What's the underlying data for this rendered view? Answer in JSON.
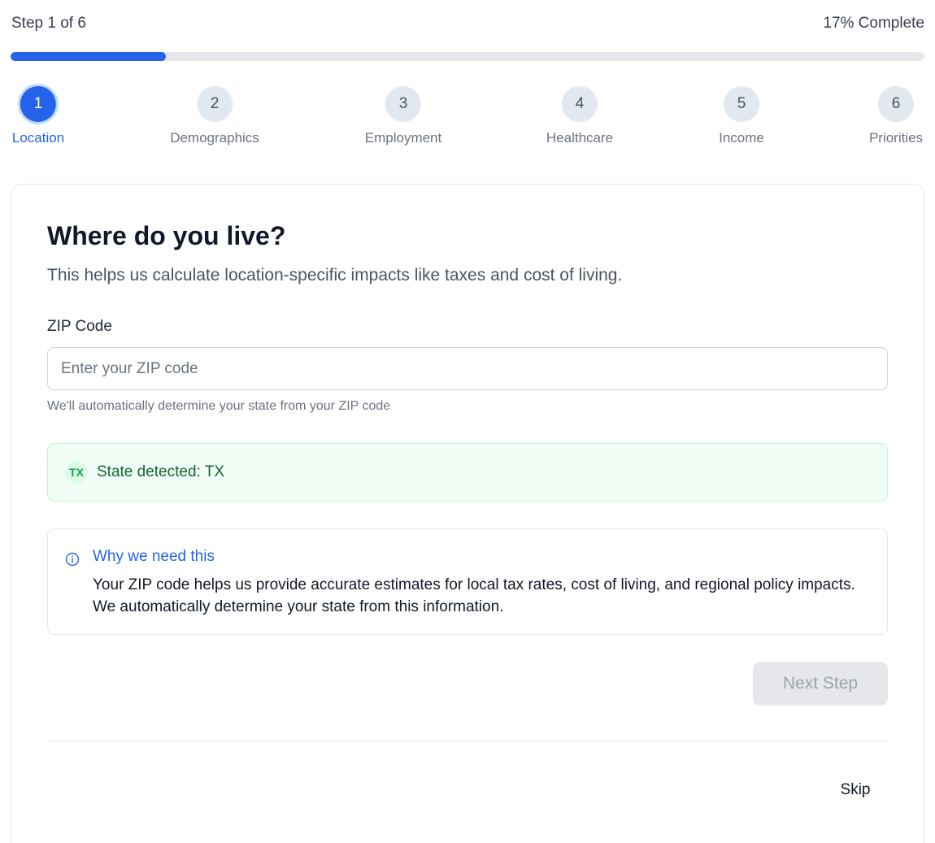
{
  "progress": {
    "step_text": "Step 1 of 6",
    "complete_text": "17% Complete",
    "fraction": 0.17,
    "accent_color": "#2563eb"
  },
  "steps": [
    {
      "number": "1",
      "label": "Location",
      "active": true
    },
    {
      "number": "2",
      "label": "Demographics",
      "active": false
    },
    {
      "number": "3",
      "label": "Employment",
      "active": false
    },
    {
      "number": "4",
      "label": "Healthcare",
      "active": false
    },
    {
      "number": "5",
      "label": "Income",
      "active": false
    },
    {
      "number": "6",
      "label": "Priorities",
      "active": false
    }
  ],
  "form": {
    "title": "Where do you live?",
    "subtitle": "This helps us calculate location-specific impacts like taxes and cost of living.",
    "zip_label": "ZIP Code",
    "zip_placeholder": "Enter your ZIP code",
    "zip_value": "",
    "zip_helper": "We'll automatically determine your state from your ZIP code"
  },
  "state_detected": {
    "badge": "TX",
    "text": "State detected: TX"
  },
  "info": {
    "icon": "info-icon",
    "title": "Why we need this",
    "body": "Your ZIP code helps us provide accurate estimates for local tax rates, cost of living, and regional policy impacts. We automatically determine your state from this information."
  },
  "actions": {
    "next_label": "Next Step",
    "skip_label": "Skip"
  }
}
